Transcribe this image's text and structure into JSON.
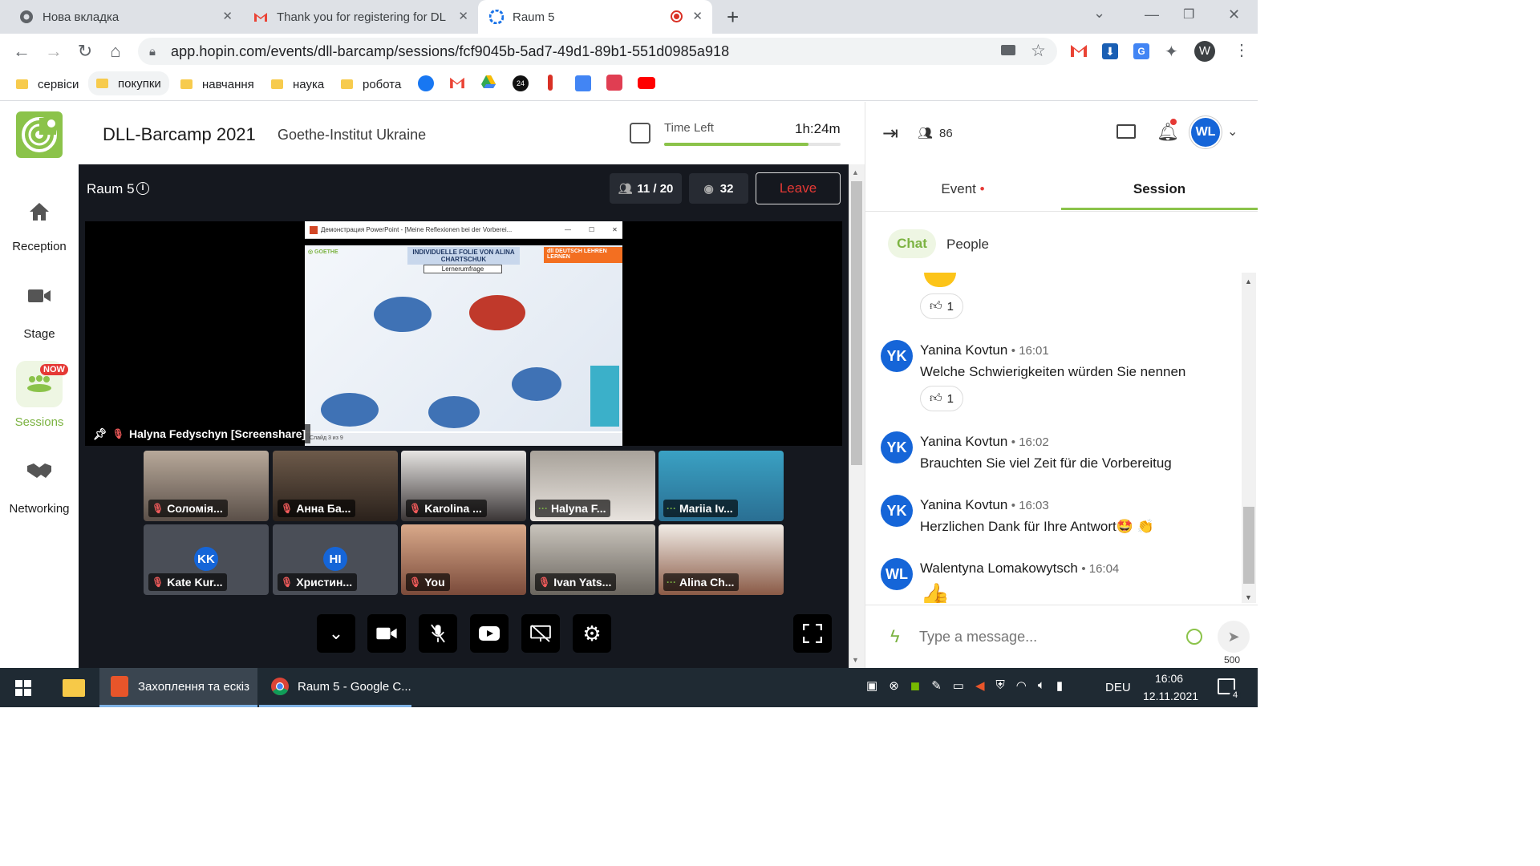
{
  "browser": {
    "tabs": [
      {
        "title": "Нова вкладка",
        "icon": "chrome-icon"
      },
      {
        "title": "Thank you for registering for DLL",
        "icon": "gmail-icon"
      },
      {
        "title": "Raum 5",
        "icon": "hopin-icon",
        "active": true
      }
    ],
    "url": "app.hopin.com/events/dll-barcamp/sessions/fcf9045b-5ad7-49d1-89b1-551d0985a918",
    "profile_initial": "W",
    "bookmarks": [
      "сервіси",
      "покупки",
      "навчання",
      "наука",
      "робота"
    ]
  },
  "header": {
    "event_title": "DLL-Barcamp 2021",
    "organizer": "Goethe-Institut Ukraine",
    "time_left_label": "Time Left",
    "time_left_value": "1h:24m",
    "time_progress": 0.82,
    "attendee_count": "86",
    "user_initials": "WL"
  },
  "nav": {
    "items": [
      {
        "label": "Reception",
        "icon": "home-icon"
      },
      {
        "label": "Stage",
        "icon": "video-camera-icon"
      },
      {
        "label": "Sessions",
        "icon": "sessions-icon",
        "badge": "NOW",
        "active": true
      },
      {
        "label": "Networking",
        "icon": "handshake-icon"
      }
    ]
  },
  "room": {
    "name": "Raum 5",
    "participants": "11 / 20",
    "viewers": "32",
    "leave_label": "Leave",
    "screenshare_label": "Halyna Fedyschyn [Screenshare]",
    "slide": {
      "window_title": "Демонстрация PowerPoint - [Meine Reflexionen bei der Vorberei...",
      "heading": "INDIVIDUELLE FOLIE VON ALINA CHARTSCHUK",
      "subheading": "Lernerumfrage",
      "status": "Слайд 3 из 9"
    },
    "tiles": [
      {
        "name": "Соломія...",
        "muted": true
      },
      {
        "name": "Анна Ба...",
        "muted": true
      },
      {
        "name": "Karolina ...",
        "muted": true
      },
      {
        "name": "Halyna F...",
        "muted": false
      },
      {
        "name": "Mariia Iv...",
        "muted": false
      },
      {
        "name": "Kate Kur...",
        "muted": true,
        "initials": "KK"
      },
      {
        "name": "Христин...",
        "muted": true,
        "initials": "HI"
      },
      {
        "name": "You",
        "muted": true
      },
      {
        "name": "Ivan Yats...",
        "muted": true
      },
      {
        "name": "Alina Ch...",
        "muted": false
      }
    ]
  },
  "sidebar": {
    "tabs": [
      {
        "label": "Event"
      },
      {
        "label": "Session"
      }
    ],
    "subtabs": [
      {
        "label": "Chat"
      },
      {
        "label": "People"
      }
    ],
    "messages": [
      {
        "initials": "YK",
        "author": "Yanina Kovtun",
        "time": "• 16:01",
        "text": "Welche Schwierigkeiten würden Sie nennen",
        "reaction": "1"
      },
      {
        "initials": "YK",
        "author": "Yanina Kovtun",
        "time": "• 16:02",
        "text": "Brauchten Sie viel Zeit für die Vorbereitug"
      },
      {
        "initials": "YK",
        "author": "Yanina Kovtun",
        "time": "• 16:03",
        "text": "Herzlichen Dank für Ihre Antwort🤩 👏"
      },
      {
        "initials": "WL",
        "author": "Walentyna Lomakowytsch",
        "time": "• 16:04",
        "text": "👍"
      }
    ],
    "top_reaction": "1",
    "input_placeholder": "Type a message...",
    "char_limit": "500"
  },
  "taskbar": {
    "apps": [
      "Захоплення та ескіз",
      "Raum 5 - Google C..."
    ],
    "lang": "DEU",
    "time": "16:06",
    "date": "12.11.2021",
    "notifications": "4"
  },
  "colors": {
    "accent": "#8bc34a",
    "leave": "#e53935",
    "avatar": "#1565d8"
  }
}
